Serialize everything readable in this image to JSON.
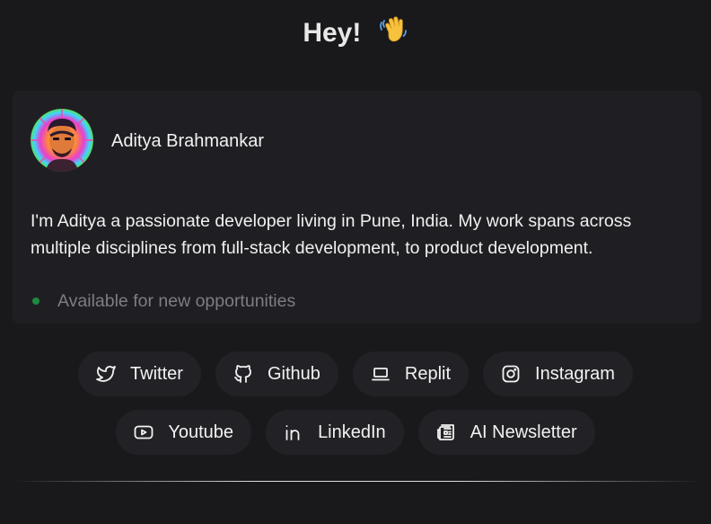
{
  "greeting": {
    "title": "Hey!",
    "emoji_icon": "waving-hand-icon"
  },
  "profile": {
    "name": "Aditya Brahmankar",
    "bio": "I'm Aditya a passionate developer living in Pune, India. My work spans across multiple disciplines from full-stack development, to product development.",
    "status": "Available for new opportunities",
    "status_color": "#1f8a3c"
  },
  "links": [
    {
      "label": "Twitter",
      "icon": "twitter-icon"
    },
    {
      "label": "Github",
      "icon": "github-icon"
    },
    {
      "label": "Replit",
      "icon": "laptop-icon"
    },
    {
      "label": "Instagram",
      "icon": "instagram-icon"
    },
    {
      "label": "Youtube",
      "icon": "youtube-icon"
    },
    {
      "label": "LinkedIn",
      "icon": "linkedin-icon"
    },
    {
      "label": "AI Newsletter",
      "icon": "newspaper-icon"
    }
  ],
  "colors": {
    "background": "#19191b",
    "card": "#1f1f23",
    "pill": "#222226"
  }
}
